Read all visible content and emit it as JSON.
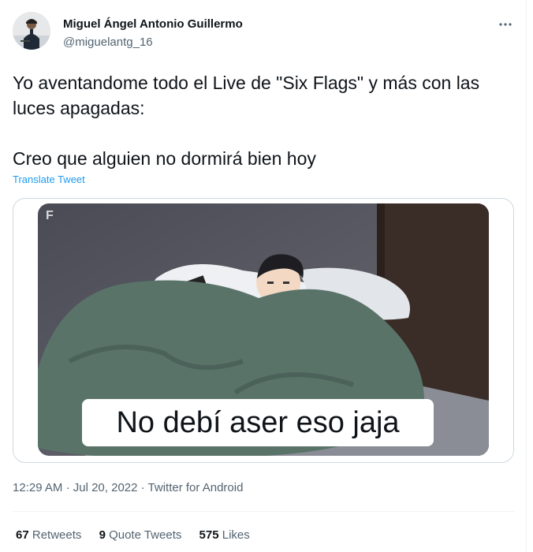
{
  "tweet": {
    "author": {
      "display_name": "Miguel Ángel Antonio Guillermo",
      "handle": "@miguelantg_16"
    },
    "more_icon": "more-horizontal-icon",
    "text_lines": [
      "Yo aventandome todo el Live de \"Six Flags\" y más con las luces apagadas:",
      "Creo que alguien no dormirá bien hoy"
    ],
    "translate_label": "Translate Tweet",
    "media": {
      "caption": "No debí aser eso jaja",
      "watermark": "F"
    },
    "time": "12:29 AM",
    "date": "Jul 20, 2022",
    "source": "Twitter for Android",
    "meta_separator": "·",
    "stats": [
      {
        "count": "67",
        "label": "Retweets"
      },
      {
        "count": "9",
        "label": "Quote Tweets"
      },
      {
        "count": "575",
        "label": "Likes"
      }
    ]
  },
  "colors": {
    "text": "#0f1419",
    "secondary": "#536471",
    "link": "#1d9bf0",
    "border": "#cfd9de"
  }
}
